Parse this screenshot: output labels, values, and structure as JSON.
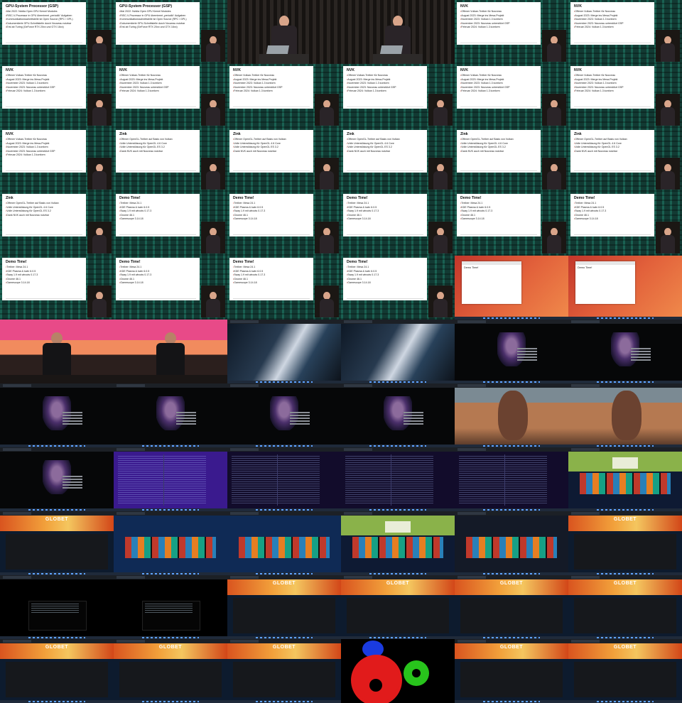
{
  "slides": {
    "gsp": {
      "title": "GPU-System Processor (GSP)",
      "bullets": [
        "Mai 2022: Nvidia Open GPU Kernel Modules",
        "RISC-V-Prozessor in GPU übernimmt „periodik“ Aufgaben",
        "Kommunikationsschnittstelle ist Open Source (RPC / GPL)",
        "Dokumentierte GPU-Schnittstelle durch Nouveau nutzbar",
        "Erst ab Turing (GeForce RTX 20xx und GTX 16xx)"
      ]
    },
    "nvk": {
      "title": "NVK",
      "bullets": [
        "Offener Vulkan-Treiber für Nouveau",
        "August 2023: Merge ins Mesa-Projekt",
        "November 2023: Vulkan 1.3 konform",
        "November 2023: Nouveau unterstützt GSP",
        "Februar 2024: Vulkan 1.3 konform"
      ]
    },
    "zink": {
      "title": "Zink",
      "bullets": [
        "Offener OpenGL-Treiber auf Basis von Vulkan",
        "Volle Unterstützung für OpenGL 4.6 Core",
        "Volle Unterstützung für OpenGL ES 3.2",
        "Dank NVK auch mit Nouveau nutzbar"
      ]
    },
    "demo": {
      "title": "Demo Time!",
      "bullets": [
        "Treiber: Mesa 24.1",
        "KDE Plasma & kwin 6.0.5",
        "Sway 1.9 mit wlroots 0.17.3",
        "Gnome 46.1",
        "Gamescope 3.14.18"
      ]
    }
  },
  "stage": {
    "screen_text": "Cyberpunk 2077 · Phantom Liberty"
  },
  "store": {
    "logo": "GLOBET"
  },
  "colors": {
    "slide_bg": "#123a33",
    "gear_red": "#e11b1b",
    "gear_blue": "#1a3be0",
    "gear_green": "#28c41c"
  }
}
